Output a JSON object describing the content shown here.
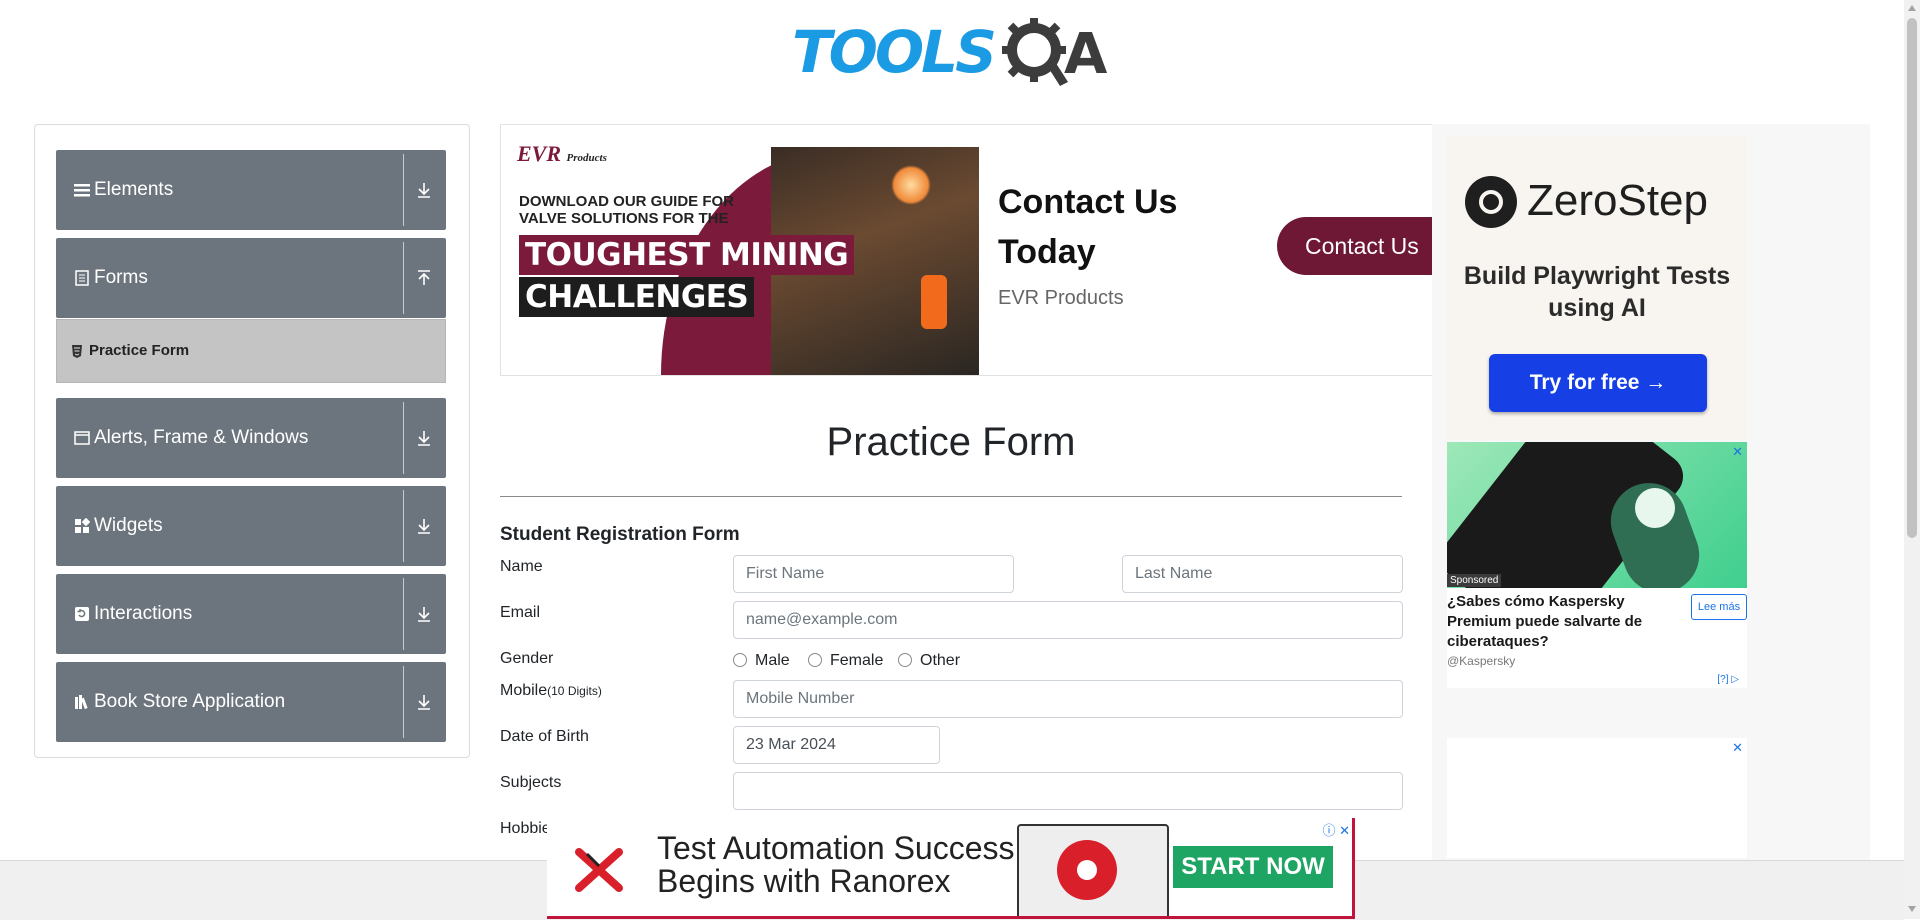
{
  "header": {
    "logo_text_primary": "TOOLS",
    "logo_text_secondary": "A"
  },
  "sidebar": {
    "groups": [
      {
        "label": "Elements",
        "icon": "hamburger-icon",
        "expanded": false
      },
      {
        "label": "Forms",
        "icon": "document-icon",
        "expanded": true
      },
      {
        "label": "Alerts, Frame & Windows",
        "icon": "window-icon",
        "expanded": false
      },
      {
        "label": "Widgets",
        "icon": "widgets-icon",
        "expanded": false
      },
      {
        "label": "Interactions",
        "icon": "interactions-icon",
        "expanded": false
      },
      {
        "label": "Book Store Application",
        "icon": "books-icon",
        "expanded": false
      }
    ],
    "active_item": {
      "label": "Practice Form",
      "icon": "html-icon"
    }
  },
  "ad_banner": {
    "brand": "EVR",
    "brand_suffix": "Products",
    "guide_text": "DOWNLOAD OUR GUIDE FOR VALVE SOLUTIONS FOR THE",
    "headline_1": "TOUGHEST MINING",
    "headline_2": "CHALLENGES",
    "contact_title": "Contact Us Today",
    "company": "EVR Products",
    "cta": "Contact Us",
    "accent_color": "#6e1836"
  },
  "ad_zerostep": {
    "name": "ZeroStep",
    "tagline": "Build Playwright Tests using AI",
    "cta": "Try for free →",
    "button_color": "#1640e6"
  },
  "ad_kaspersky": {
    "sponsored": "Sponsored",
    "question": "¿Sabes cómo Kaspersky Premium puede salvarte de ciberataques?",
    "more": "Lee más",
    "source": "@Kaspersky",
    "info": "[?]",
    "close": "✕"
  },
  "ad_blank": {
    "close": "✕"
  },
  "form": {
    "page_title": "Practice Form",
    "section_title": "Student Registration Form",
    "name_label": "Name",
    "first_name_placeholder": "First Name",
    "last_name_placeholder": "Last Name",
    "email_label": "Email",
    "email_placeholder": "name@example.com",
    "gender_label": "Gender",
    "gender_options": [
      "Male",
      "Female",
      "Other"
    ],
    "mobile_label": "Mobile",
    "mobile_hint": "(10 Digits)",
    "mobile_placeholder": "Mobile Number",
    "dob_label": "Date of Birth",
    "dob_value": "23 Mar 2024",
    "subjects_label": "Subjects",
    "subjects_value": "",
    "hobbies_label": "Hobbies"
  },
  "ad_bottom": {
    "headline_line1": "Test Automation Success",
    "headline_line2": "Begins with Ranorex",
    "cta": "START NOW",
    "cta_color": "#1fa563"
  }
}
